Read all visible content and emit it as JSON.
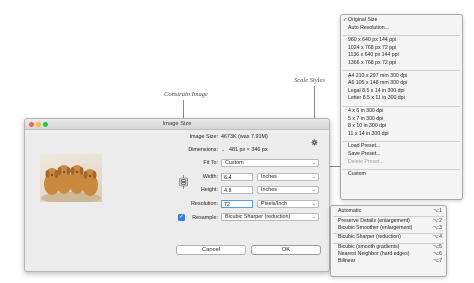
{
  "callouts": {
    "constrain": "Constrain Image",
    "scale_styles": "Scale Styles"
  },
  "dialog": {
    "title": "Image Size",
    "image_size_label": "Image Size:",
    "image_size_value": "4673K (was 7.91M)",
    "dimensions_label": "Dimensions:",
    "dimensions_value": "481 px × 346 px",
    "fit_to_label": "Fit To:",
    "fit_to_value": "Custom",
    "width_label": "Width:",
    "width_value": "6.4",
    "width_unit": "Inches",
    "height_label": "Height:",
    "height_value": "4.8",
    "height_unit": "Inches",
    "resolution_label": "Resolution:",
    "resolution_value": "72",
    "resolution_unit": "Pixels/Inch",
    "resample_label": "Resample:",
    "resample_checked": true,
    "resample_value": "Bicubic Sharper (reduction)",
    "cancel": "Cancel",
    "ok": "OK"
  },
  "fit_menu": {
    "items": [
      {
        "label": "Original Size",
        "checked": true
      },
      {
        "label": "Auto Resolution..."
      },
      {
        "sep": true
      },
      {
        "label": "960 x 640 px 144 ppi"
      },
      {
        "label": "1024 x 768 px 72 ppi"
      },
      {
        "label": "1136 x 640 px 144 ppi"
      },
      {
        "label": "1366 x 768 px 72 ppi"
      },
      {
        "sep": true
      },
      {
        "label": "A4 210 x 297 mm 300 dpi"
      },
      {
        "label": "A6 105 x 148 mm 300 dpi"
      },
      {
        "label": "Legal 8.5 x 14 in 300 dpi"
      },
      {
        "label": "Letter 8.5 x 11 in 300 dpi"
      },
      {
        "sep": true
      },
      {
        "label": "4 x 6 in 300 dpi"
      },
      {
        "label": "5 x 7 in 300 dpi"
      },
      {
        "label": "8 x 10 in 300 dpi"
      },
      {
        "label": "11 x 14 in 300 dpi"
      },
      {
        "sep": true
      },
      {
        "label": "Load Preset..."
      },
      {
        "label": "Save Preset..."
      },
      {
        "label": "Delete Preset...",
        "disabled": true
      },
      {
        "sep": true
      },
      {
        "label": "Custom"
      }
    ]
  },
  "resample_menu": {
    "items": [
      {
        "label": "Automatic",
        "shortcut": "⌥1"
      },
      {
        "sep": true
      },
      {
        "label": "Preserve Details (enlargement)",
        "shortcut": "⌥2"
      },
      {
        "label": "Bicubic Smoother (enlargement)",
        "shortcut": "⌥3"
      },
      {
        "sep": true
      },
      {
        "label": "Bicubic Sharper (reduction)",
        "shortcut": "⌥4"
      },
      {
        "sep": true
      },
      {
        "label": "Bicubic (smooth gradients)",
        "shortcut": "⌥5"
      },
      {
        "label": "Nearest Neighbor (hard edges)",
        "shortcut": "⌥6"
      },
      {
        "label": "Bilinear",
        "shortcut": "⌥7"
      }
    ]
  }
}
